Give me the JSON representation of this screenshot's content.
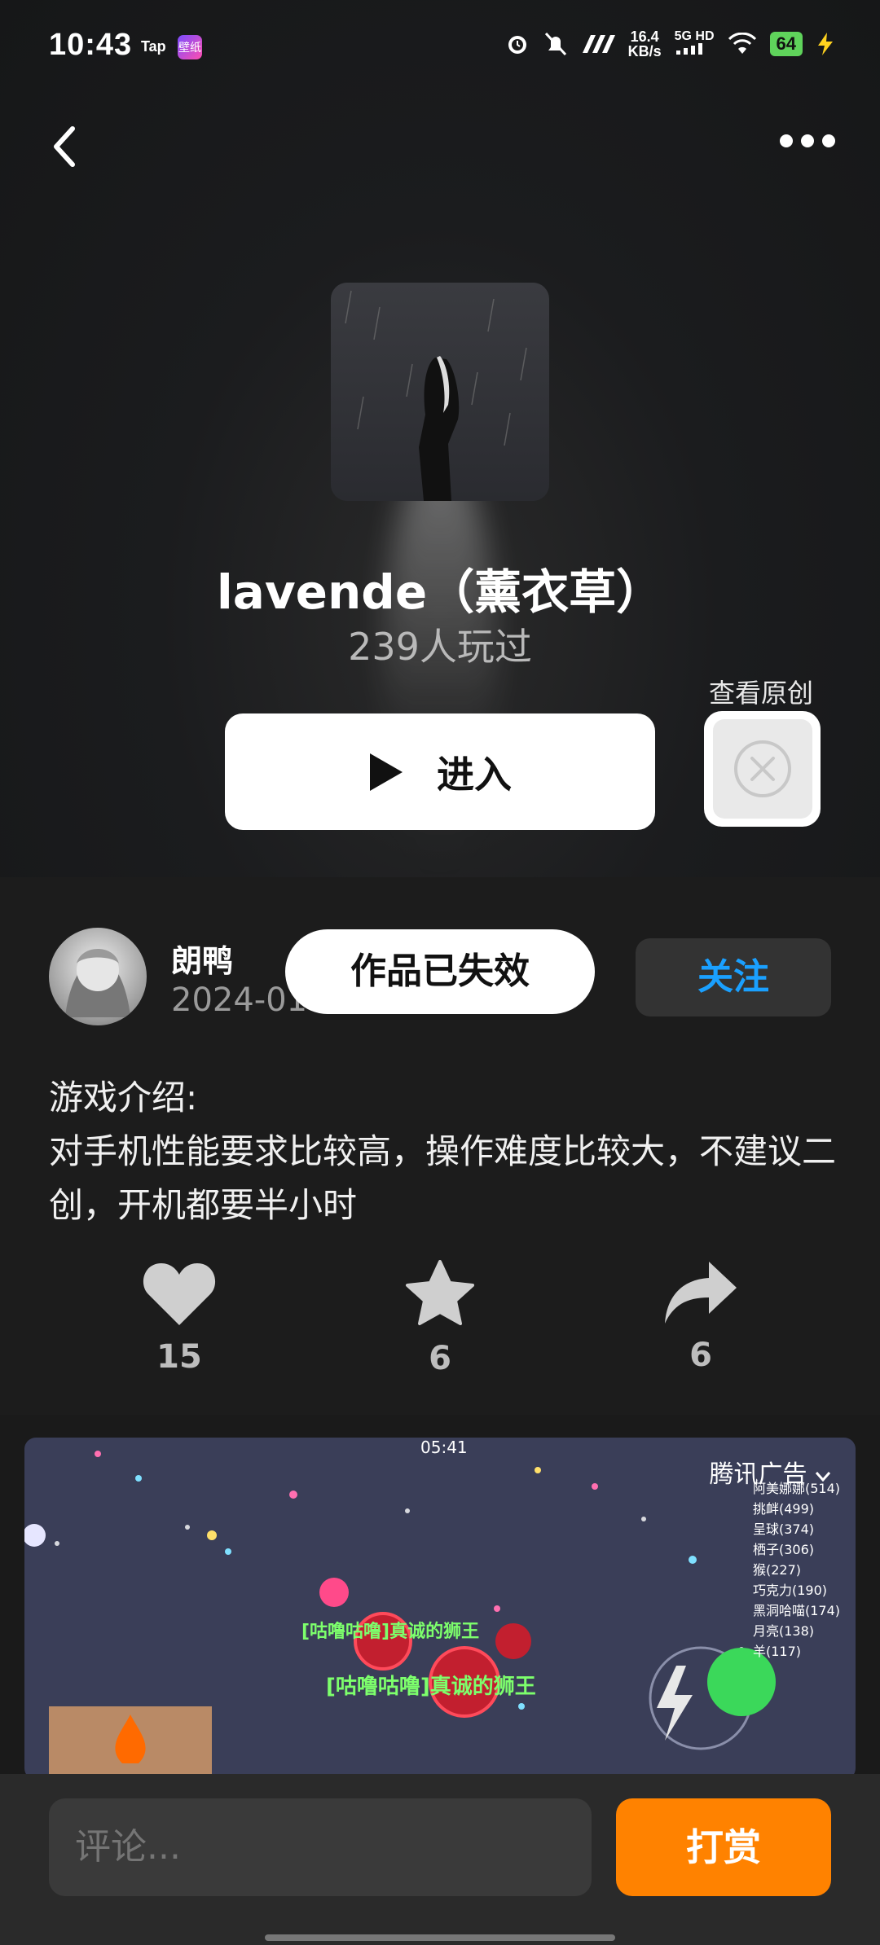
{
  "status_bar": {
    "time": "10:43",
    "tap_label": "Tap",
    "app_badge": "壁纸",
    "net_speed_value": "16.4",
    "net_speed_unit": "KB/s",
    "network": "5G HD",
    "battery": "64"
  },
  "game": {
    "title": "lavende（薰衣草）",
    "played": "239人玩过",
    "view_original_label": "查看原创",
    "enter_label": "进入"
  },
  "author": {
    "name": "朗鸭",
    "date": "2024-01",
    "invalid_notice": "作品已失效",
    "follow_label": "关注"
  },
  "intro": {
    "heading": "游戏介绍:",
    "body": "对手机性能要求比较高，操作难度比较大，不建议二创，开机都要半小时"
  },
  "stats": {
    "likes": "15",
    "favorites": "6",
    "shares": "6"
  },
  "ad": {
    "label": "腾讯广告",
    "game_time": "05:41",
    "leaderboard": [
      "阿美娜娜(514)",
      "挑衅(499)",
      "呈球(374)",
      "栖子(306)",
      "猴(227)",
      "巧克力(190)",
      "黑洞哈喵(174)",
      "月亮(138)",
      "羊(117)"
    ],
    "overlay_text_1": "[咕噜咕噜]真诚的狮王",
    "overlay_text_2": "[咕噜咕噜]真诚的狮王"
  },
  "bottom_bar": {
    "comment_placeholder": "评论...",
    "tip_label": "打赏"
  },
  "colors": {
    "accent_orange": "#ff8200",
    "follow_blue": "#1aa0ff"
  }
}
